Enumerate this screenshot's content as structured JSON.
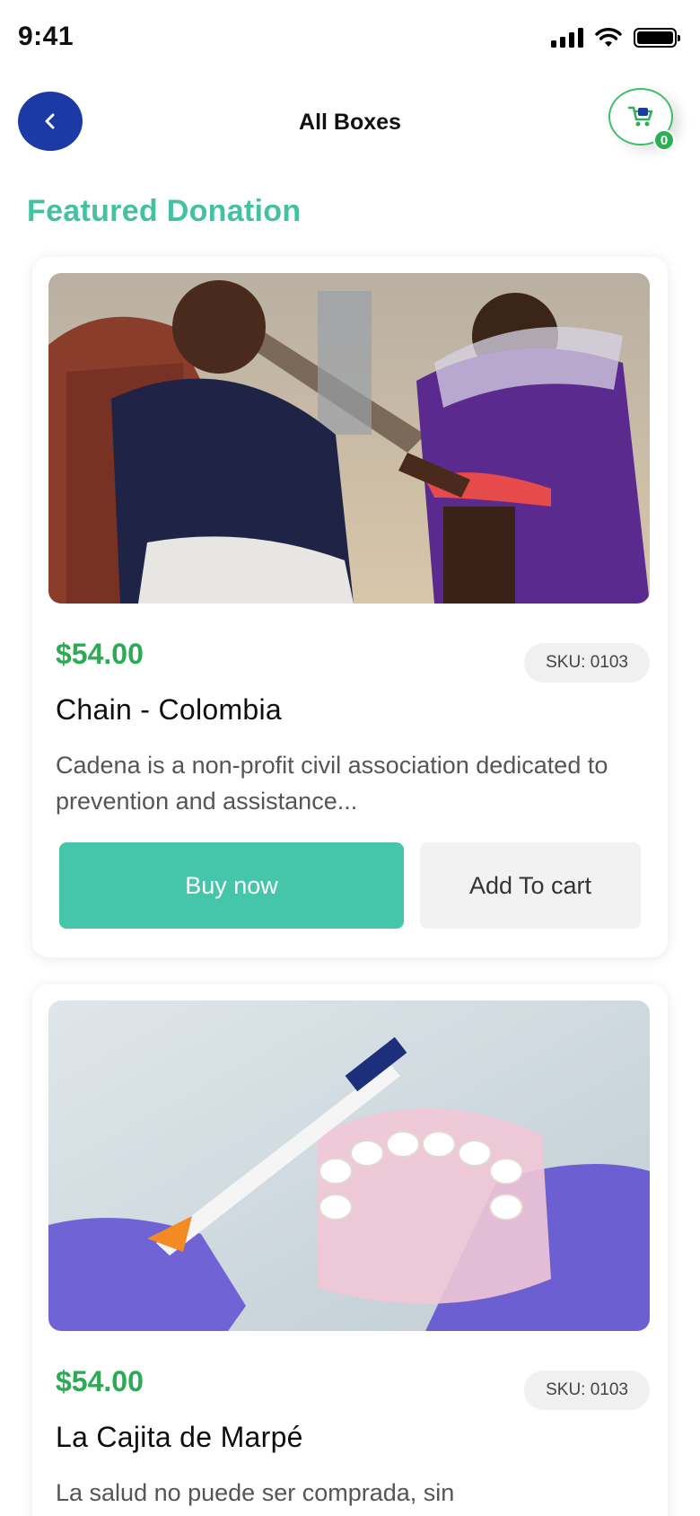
{
  "status_bar": {
    "time": "9:41"
  },
  "header": {
    "title": "All Boxes",
    "cart_count": "0"
  },
  "section": {
    "title": "Featured Donation"
  },
  "products": [
    {
      "price": "$54.00",
      "sku": "SKU: 0103",
      "name": "Chain - Colombia",
      "description": "Cadena is a non-profit civil association dedicated to prevention and assistance...",
      "buy_label": "Buy now",
      "cart_label": "Add To cart"
    },
    {
      "price": "$54.00",
      "sku": "SKU: 0103",
      "name": "La Cajita de Marpé",
      "description": "La salud no puede ser comprada, sin"
    }
  ],
  "icons": {
    "back": "chevron-left-icon",
    "cart": "shopping-cart-icon",
    "signal": "signal-icon",
    "wifi": "wifi-icon",
    "battery": "battery-icon"
  },
  "colors": {
    "primary_blue": "#1b3aa6",
    "accent_teal": "#45c6aa",
    "price_green": "#2eaa56",
    "section_title": "#44c1a3"
  }
}
